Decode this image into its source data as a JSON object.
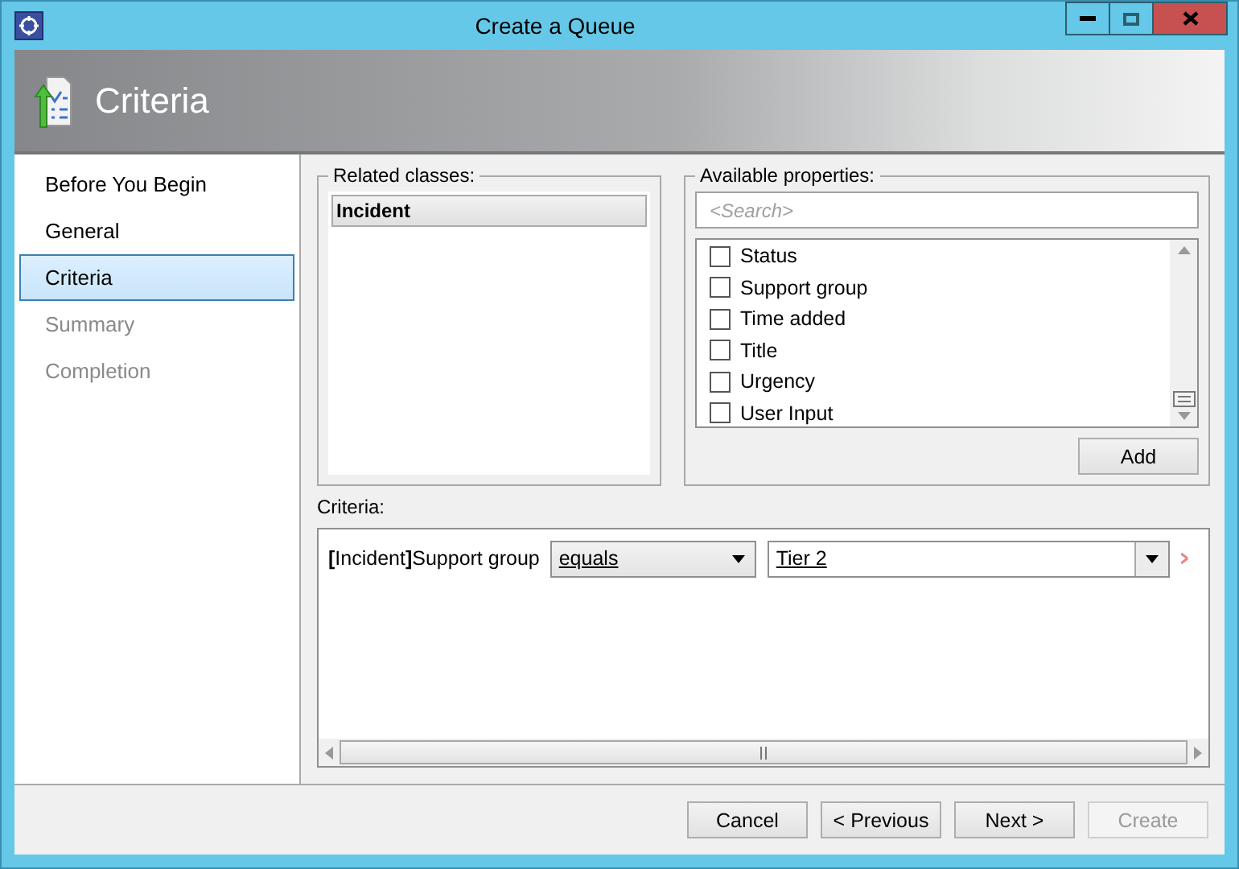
{
  "window": {
    "title": "Create a Queue"
  },
  "header": {
    "title": "Criteria"
  },
  "steps": [
    {
      "label": "Before You Begin",
      "selected": false,
      "disabled": false
    },
    {
      "label": "General",
      "selected": false,
      "disabled": false
    },
    {
      "label": "Criteria",
      "selected": true,
      "disabled": false
    },
    {
      "label": "Summary",
      "selected": false,
      "disabled": true
    },
    {
      "label": "Completion",
      "selected": false,
      "disabled": true
    }
  ],
  "related_classes": {
    "label": "Related classes:",
    "items": [
      {
        "label": "Incident",
        "selected": true
      }
    ]
  },
  "available_properties": {
    "label": "Available properties:",
    "placeholder": "<Search>",
    "items": [
      {
        "label": "Status",
        "checked": false
      },
      {
        "label": "Support group",
        "checked": false
      },
      {
        "label": "Time added",
        "checked": false
      },
      {
        "label": "Title",
        "checked": false
      },
      {
        "label": "Urgency",
        "checked": false
      },
      {
        "label": "User Input",
        "checked": false
      }
    ],
    "add_button": "Add"
  },
  "criteria": {
    "label": "Criteria:",
    "rows": [
      {
        "label": "**[**Incident**]**Support group",
        "operator": "equals",
        "value": "Tier 2"
      }
    ]
  },
  "buttons": [
    {
      "label": "Cancel",
      "disabled": false
    },
    {
      "label": "< Previous",
      "disabled": false
    },
    {
      "label": "Next >",
      "disabled": false
    },
    {
      "label": "Create",
      "disabled": true
    }
  ]
}
